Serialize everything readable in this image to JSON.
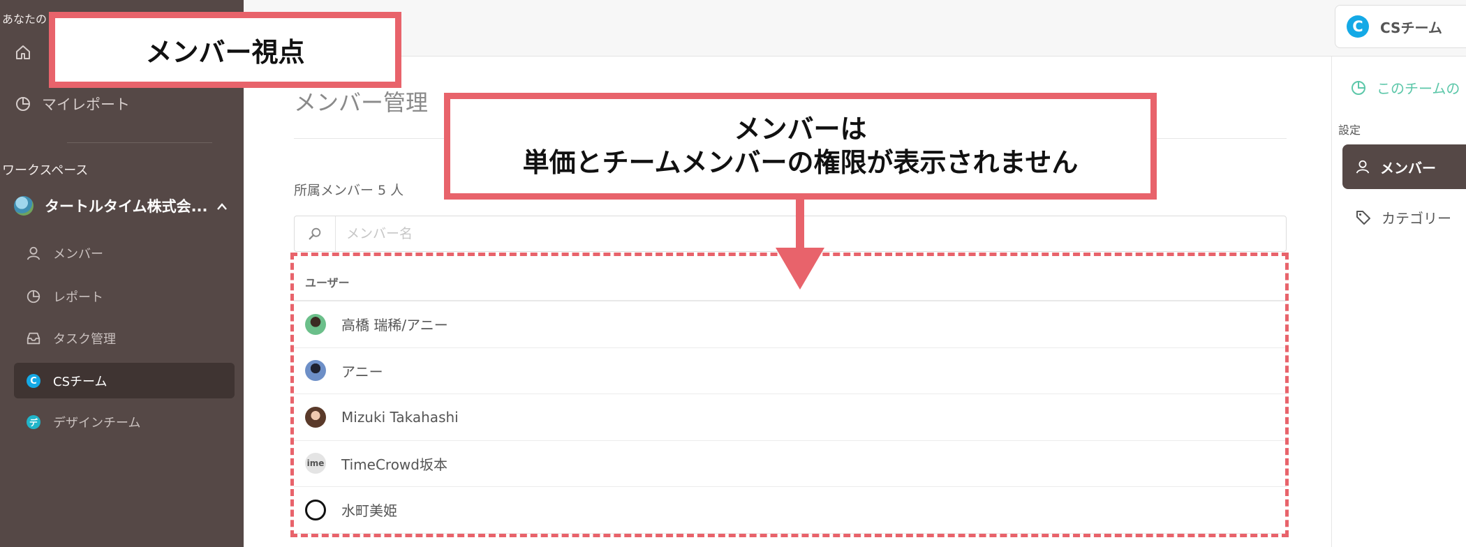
{
  "sidebar": {
    "top_label": "あなたの",
    "my_report_label": "マイレポート",
    "section_label": "ワークスペース",
    "workspace_name": "タートルタイム株式会...",
    "items": [
      {
        "label": "メンバー",
        "icon": "user-icon"
      },
      {
        "label": "レポート",
        "icon": "report-icon"
      },
      {
        "label": "タスク管理",
        "icon": "inbox-icon"
      },
      {
        "label": "CSチーム",
        "icon": "team-c-icon",
        "badge": "C",
        "active": true
      },
      {
        "label": "デザインチーム",
        "icon": "team-de-icon",
        "badge": "デ"
      }
    ]
  },
  "topbar": {
    "team_switch_label": "CSチーム",
    "team_switch_badge": "C"
  },
  "main": {
    "title": "メンバー管理",
    "member_count": "所属メンバー 5 人",
    "search_placeholder": "メンバー名",
    "table_header": "ユーザー",
    "members": [
      {
        "name": "高橋 瑞稀/アニー"
      },
      {
        "name": "アニー"
      },
      {
        "name": "Mizuki Takahashi"
      },
      {
        "name": "TimeCrowd坂本",
        "avatar_text": "ime"
      },
      {
        "name": "水町美姫"
      }
    ]
  },
  "right_panel": {
    "link_label": "このチームの",
    "section_label": "設定",
    "items": [
      {
        "label": "メンバー",
        "icon": "user-icon",
        "active": true
      },
      {
        "label": "カテゴリー",
        "icon": "tag-icon"
      }
    ]
  },
  "annotations": {
    "callout_title": "メンバー視点",
    "callout_line1": "メンバーは",
    "callout_line2": "単価とチームメンバーの権限が表示されません",
    "accent_color": "#e8636b"
  },
  "colors": {
    "sidebar_bg": "#554846",
    "sidebar_active_bg": "#3f3432",
    "link_green": "#5cc7a9",
    "team_blue": "#14a9e6"
  }
}
